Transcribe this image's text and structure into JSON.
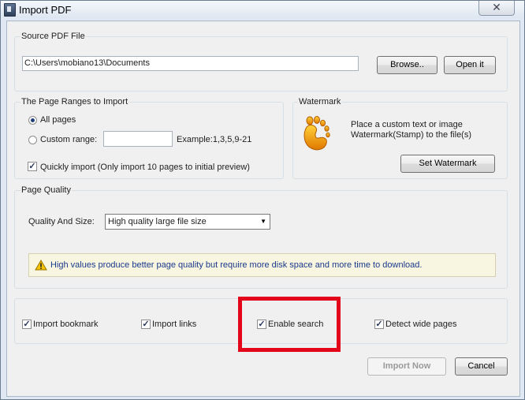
{
  "window": {
    "title": "Import PDF",
    "close_glyph": "✕"
  },
  "source": {
    "label": "Source PDF File",
    "path": "C:\\Users\\mobiano13\\Documents",
    "browse": "Browse..",
    "open": "Open it"
  },
  "ranges": {
    "label": "The Page Ranges to Import",
    "all_pages": "All pages",
    "custom_range": "Custom range:",
    "custom_value": "",
    "example": "Example:1,3,5,9-21",
    "quick_import": "Quickly import (Only import 10 pages to  initial  preview)",
    "all_selected": true,
    "quick_checked": true
  },
  "watermark": {
    "label": "Watermark",
    "desc_line1": "Place a custom text or image",
    "desc_line2": "Watermark(Stamp) to the file(s)",
    "button": "Set Watermark",
    "icon": "footprint-icon"
  },
  "quality": {
    "label": "Page Quality",
    "size_label": "Quality And Size:",
    "selected": "High quality large file size",
    "warning": "High values produce better page quality but require more disk space and more time to download.",
    "warn_icon": "warning-triangle-icon"
  },
  "options": [
    {
      "label": "Import bookmark",
      "checked": true
    },
    {
      "label": "Import links",
      "checked": true
    },
    {
      "label": "Enable search",
      "checked": true
    },
    {
      "label": "Detect wide pages",
      "checked": true
    }
  ],
  "footer": {
    "import_now": "Import Now",
    "cancel": "Cancel"
  },
  "colors": {
    "highlight_box": "#e3061a",
    "warning_text": "#1a3a8a",
    "warning_bg": "#f8f5e1"
  }
}
